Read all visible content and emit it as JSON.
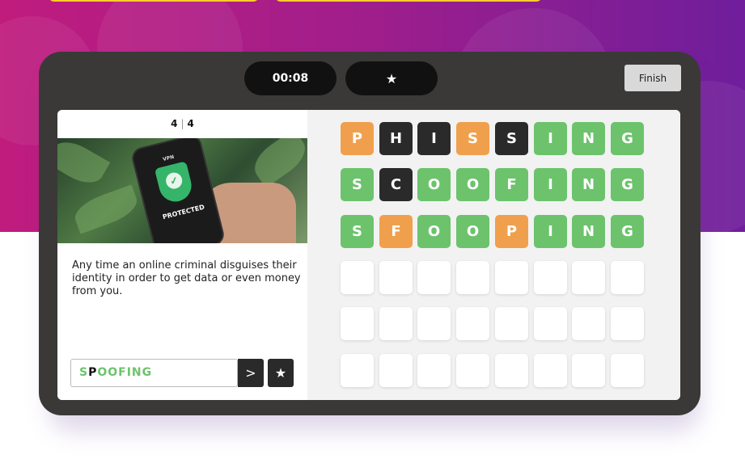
{
  "hud": {
    "timer": "00:08",
    "star": "★",
    "finish_label": "Finish"
  },
  "question": {
    "current": "4",
    "total": "4",
    "separator": "|",
    "image_text_top": "VPN",
    "image_text_badge": "PROTECTED",
    "clue": "Any time an online criminal disguises their identity in order to get data or even money from you."
  },
  "answer": {
    "value_first": "S",
    "value_hit": "P",
    "value_rest": "OOFING",
    "submit_glyph": ">",
    "hint_glyph": "★"
  },
  "colors": {
    "correct": "#6cc36c",
    "present": "#f0a04c",
    "absent": "#2a2a2a",
    "frame": "#3a3938",
    "hero_left": "#c01c7e",
    "hero_right": "#6f1e9c"
  },
  "board": {
    "rows": [
      [
        [
          "P",
          "present"
        ],
        [
          "H",
          "absent"
        ],
        [
          "I",
          "absent"
        ],
        [
          "S",
          "present"
        ],
        [
          "S",
          "absent"
        ],
        [
          "I",
          "correct"
        ],
        [
          "N",
          "correct"
        ],
        [
          "G",
          "correct"
        ]
      ],
      [
        [
          "S",
          "correct"
        ],
        [
          "C",
          "absent"
        ],
        [
          "O",
          "correct"
        ],
        [
          "O",
          "correct"
        ],
        [
          "F",
          "correct"
        ],
        [
          "I",
          "correct"
        ],
        [
          "N",
          "correct"
        ],
        [
          "G",
          "correct"
        ]
      ],
      [
        [
          "S",
          "correct"
        ],
        [
          "F",
          "present"
        ],
        [
          "O",
          "correct"
        ],
        [
          "O",
          "correct"
        ],
        [
          "P",
          "present"
        ],
        [
          "I",
          "correct"
        ],
        [
          "N",
          "correct"
        ],
        [
          "G",
          "correct"
        ]
      ],
      [
        [
          "",
          "empty"
        ],
        [
          "",
          "empty"
        ],
        [
          "",
          "empty"
        ],
        [
          "",
          "empty"
        ],
        [
          "",
          "empty"
        ],
        [
          "",
          "empty"
        ],
        [
          "",
          "empty"
        ],
        [
          "",
          "empty"
        ]
      ],
      [
        [
          "",
          "empty"
        ],
        [
          "",
          "empty"
        ],
        [
          "",
          "empty"
        ],
        [
          "",
          "empty"
        ],
        [
          "",
          "empty"
        ],
        [
          "",
          "empty"
        ],
        [
          "",
          "empty"
        ],
        [
          "",
          "empty"
        ]
      ],
      [
        [
          "",
          "empty"
        ],
        [
          "",
          "empty"
        ],
        [
          "",
          "empty"
        ],
        [
          "",
          "empty"
        ],
        [
          "",
          "empty"
        ],
        [
          "",
          "empty"
        ],
        [
          "",
          "empty"
        ],
        [
          "",
          "empty"
        ]
      ]
    ]
  }
}
